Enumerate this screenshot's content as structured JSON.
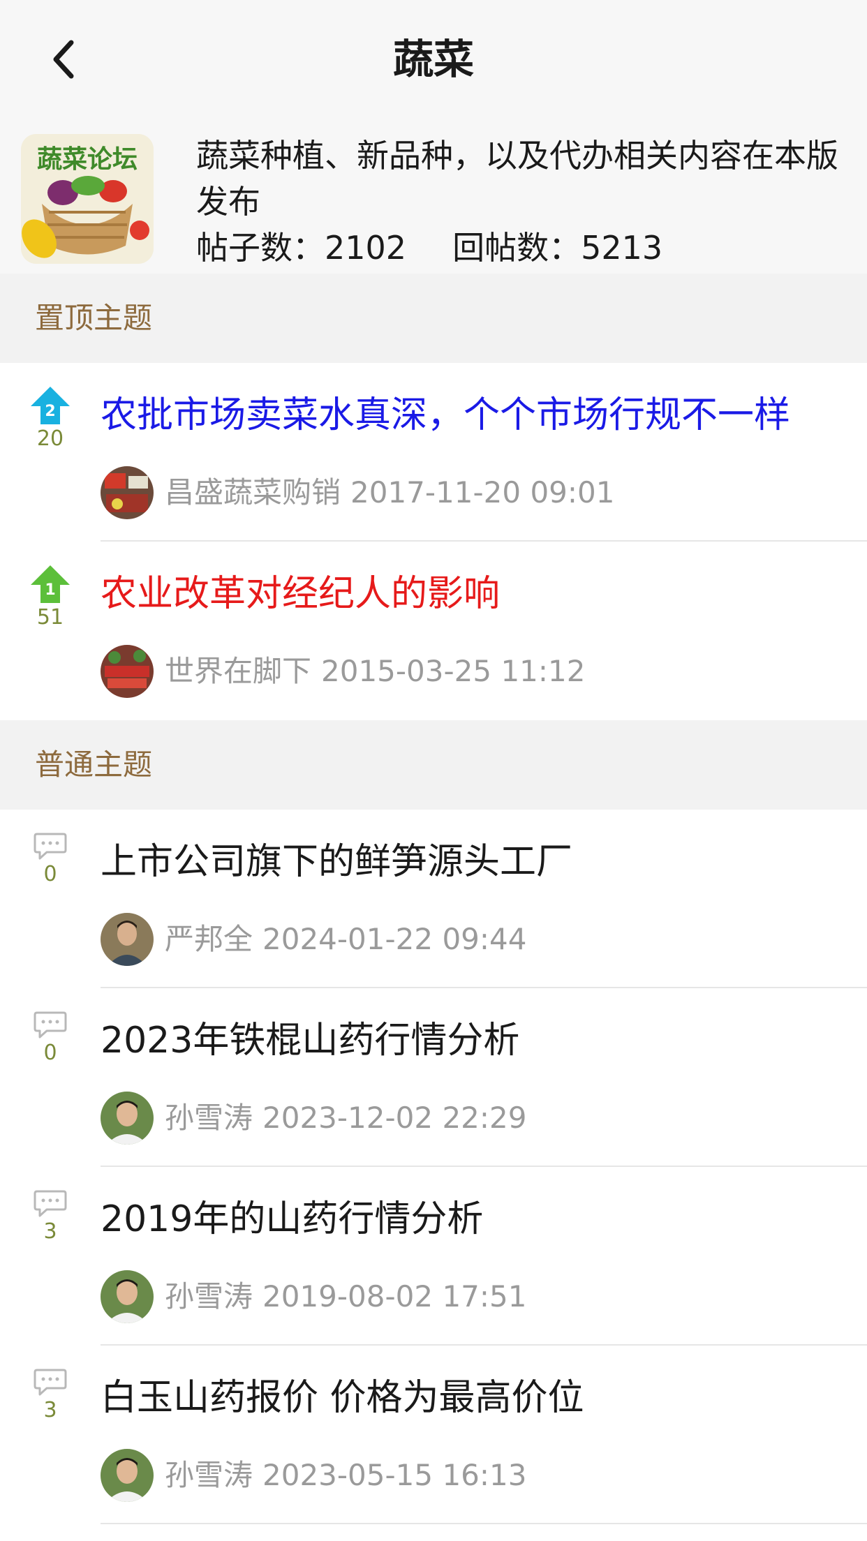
{
  "nav": {
    "title": "蔬菜",
    "back_icon": "chevron-left-icon"
  },
  "forum": {
    "description": "蔬菜种植、新品种，以及代办相关内容在本版发布",
    "posts_label": "帖子数：2102",
    "replies_label": "回帖数：5213",
    "logo_text": "蔬菜论坛"
  },
  "sections": {
    "pinned": "置顶主题",
    "normal": "普通主题"
  },
  "pinned_topics": [
    {
      "title": "农批市场卖菜水真深，个个市场行规不一样",
      "count": "20",
      "rank": "2",
      "author": "昌盛蔬菜购销",
      "date": "2017-11-20 09:01",
      "title_color": "#1a1ae6",
      "badge_color": "#19b1e0"
    },
    {
      "title": "农业改革对经纪人的影响",
      "count": "51",
      "rank": "1",
      "author": "世界在脚下",
      "date": "2015-03-25 11:12",
      "title_color": "#e61a1a",
      "badge_color": "#5cbf3a"
    }
  ],
  "topics": [
    {
      "title": "上市公司旗下的鲜笋源头工厂",
      "count": "0",
      "author": "严邦全",
      "date": "2024-01-22 09:44"
    },
    {
      "title": "2023年铁棍山药行情分析",
      "count": "0",
      "author": "孙雪涛",
      "date": "2023-12-02 22:29"
    },
    {
      "title": "2019年的山药行情分析",
      "count": "3",
      "author": "孙雪涛",
      "date": "2019-08-02 17:51"
    },
    {
      "title": "白玉山药报价 价格为最高价位",
      "count": "3",
      "author": "孙雪涛",
      "date": "2023-05-15 16:13"
    }
  ],
  "colors": {
    "section_text": "#8d6a3d",
    "count_text": "#7a8a38",
    "meta_text": "#9a9a9a"
  }
}
